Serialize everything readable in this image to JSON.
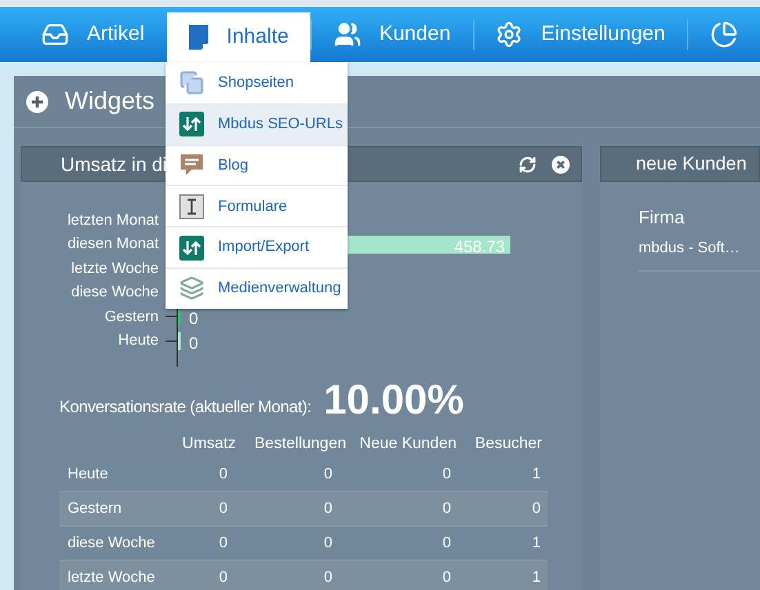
{
  "nav": [
    {
      "label": "Artikel",
      "kind": "tray",
      "selected": false
    },
    {
      "label": "Inhalte",
      "kind": "document",
      "selected": true
    },
    {
      "label": "Kunden",
      "kind": "users",
      "selected": false
    },
    {
      "label": "Einstellungen",
      "kind": "gear",
      "selected": false
    },
    {
      "kind": "pie",
      "selected": false
    }
  ],
  "menu": [
    {
      "label": "Shopseiten",
      "kind": "pages",
      "selected": false
    },
    {
      "label": "Mbdus SEO-URLs",
      "kind": "arrows",
      "selected": true
    },
    {
      "label": "Blog",
      "kind": "bubble",
      "selected": false
    },
    {
      "label": "Formulare",
      "kind": "ibeam",
      "selected": false
    },
    {
      "label": "Import/Export",
      "kind": "arrows",
      "selected": false
    },
    {
      "label": "Medienverwaltung",
      "kind": "layers",
      "selected": false
    }
  ],
  "widgets": {
    "title": "Widgets",
    "sales": {
      "title": "Umsatz in di",
      "bars": [
        {
          "label": "letzten Monat"
        },
        {
          "label": "diesen Monat",
          "value": "458.73",
          "color": "#a4e5cc"
        },
        {
          "label": "letzte Woche"
        },
        {
          "label": "diese Woche"
        },
        {
          "label": "Gestern",
          "value": "0",
          "color": "#2fbf71"
        },
        {
          "label": "Heute",
          "value": "0",
          "color": "#a8e6c8"
        }
      ],
      "conversion_label": "Konversationsrate (aktueller Monat):",
      "conversion_value": "10.00%",
      "columns": [
        "Umsatz",
        "Bestellungen",
        "Neue Kunden",
        "Besucher"
      ],
      "rows": [
        {
          "label": "Heute",
          "cells": [
            "0",
            "0",
            "0",
            "1"
          ]
        },
        {
          "label": "Gestern",
          "cells": [
            "0",
            "0",
            "0",
            "0"
          ]
        },
        {
          "label": "diese Woche",
          "cells": [
            "0",
            "0",
            "0",
            "1"
          ]
        },
        {
          "label": "letzte Woche",
          "cells": [
            "0",
            "0",
            "0",
            "1"
          ]
        }
      ]
    },
    "customers": {
      "title": "neue Kunden",
      "column": "Firma",
      "rows": [
        "mbdus - Soft…"
      ]
    }
  }
}
